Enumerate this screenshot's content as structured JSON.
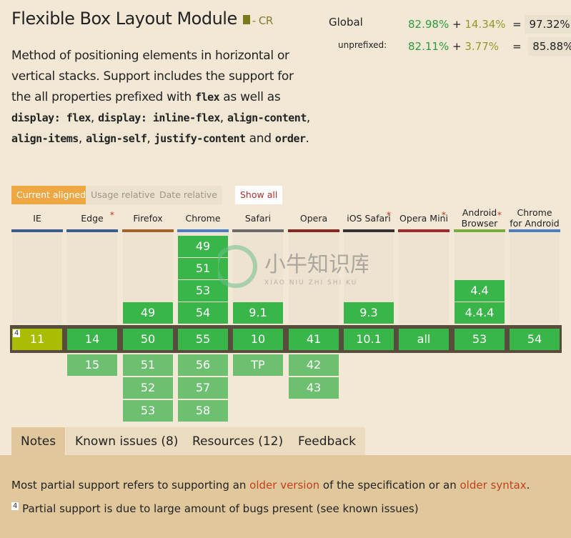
{
  "title": "Flexible Box Layout Module",
  "status": "- CR",
  "description": {
    "p1": "Method of positioning elements in horizontal or vertical stacks. Support includes the support for the all properties prefixed with ",
    "c1": "flex",
    "p2": " as well as ",
    "c2": "display: flex",
    "s2": ", ",
    "c3": "display: inline-flex",
    "s3": ", ",
    "c4": "align-content",
    "s4": ", ",
    "c5": "align-items",
    "s5": ", ",
    "c6": "align-self",
    "s6": ", ",
    "c7": "justify-content",
    "p3": " and ",
    "c8": "order",
    "p4": "."
  },
  "stats": {
    "global": {
      "label": "Global",
      "full": "82.98%",
      "plus": "+",
      "partial": "14.34%",
      "eq": "=",
      "total": "97.32%"
    },
    "unprefixed": {
      "label": "unprefixed:",
      "full": "82.11%",
      "plus": "+",
      "partial": "3.77%",
      "eq": "=",
      "total": "85.88%"
    }
  },
  "view_buttons": [
    "Current aligned",
    "Usage relative",
    "Date relative"
  ],
  "show_all": "Show all",
  "colors": {
    "supported": "#39b54a",
    "future": "#6cc070",
    "partial": "#a8bd04",
    "band": "#584d3c"
  },
  "browsers": [
    {
      "name": "IE",
      "star": false,
      "color": "#3b5d8f",
      "past": [],
      "current": "11",
      "current_note": "4",
      "partial": true,
      "future": []
    },
    {
      "name": "Edge",
      "star": true,
      "color": "#3b5d8f",
      "past": [],
      "current": "14",
      "future": [
        "15"
      ]
    },
    {
      "name": "Firefox",
      "star": false,
      "color": "#a5622b",
      "past": [
        "49"
      ],
      "current": "50",
      "future": [
        "51",
        "52",
        "53"
      ]
    },
    {
      "name": "Chrome",
      "star": false,
      "color": "#4a7fc1",
      "past": [
        "49",
        "51",
        "53",
        "54"
      ],
      "current": "55",
      "future": [
        "56",
        "57",
        "58"
      ]
    },
    {
      "name": "Safari",
      "star": false,
      "color": "#6b6b6b",
      "past": [
        "9.1"
      ],
      "current": "10",
      "future": [
        "TP"
      ]
    },
    {
      "name": "Opera",
      "star": false,
      "color": "#8b2323",
      "past": [],
      "current": "41",
      "future": [
        "42",
        "43"
      ]
    },
    {
      "name": "iOS Safari",
      "star": true,
      "color": "#333333",
      "past": [
        "9.3"
      ],
      "current": "10.1",
      "future": []
    },
    {
      "name": "Opera Mini",
      "star": true,
      "color": "#a02a2a",
      "past": [],
      "current": "all",
      "future": []
    },
    {
      "name": "Android Browser",
      "star": true,
      "color": "#7aad3f",
      "past": [
        "4.4",
        "4.4.4"
      ],
      "current": "53",
      "future": []
    },
    {
      "name": "Chrome for Android",
      "star": false,
      "color": "#4a7fc1",
      "past": [],
      "current": "54",
      "future": []
    }
  ],
  "tabs": [
    "Notes",
    "Known issues (8)",
    "Resources (12)",
    "Feedback"
  ],
  "notes": {
    "t1": "Most partial support refers to supporting an ",
    "l1": "older version",
    "t2": " of the specification or an ",
    "l2": "older syntax",
    "t3": ".",
    "n_num": "4",
    "n_text": "Partial support is due to large amount of bugs present (see known issues)"
  },
  "watermark": {
    "cn": "小牛知识库",
    "en": "XIAO NIU ZHI SHI KU"
  }
}
